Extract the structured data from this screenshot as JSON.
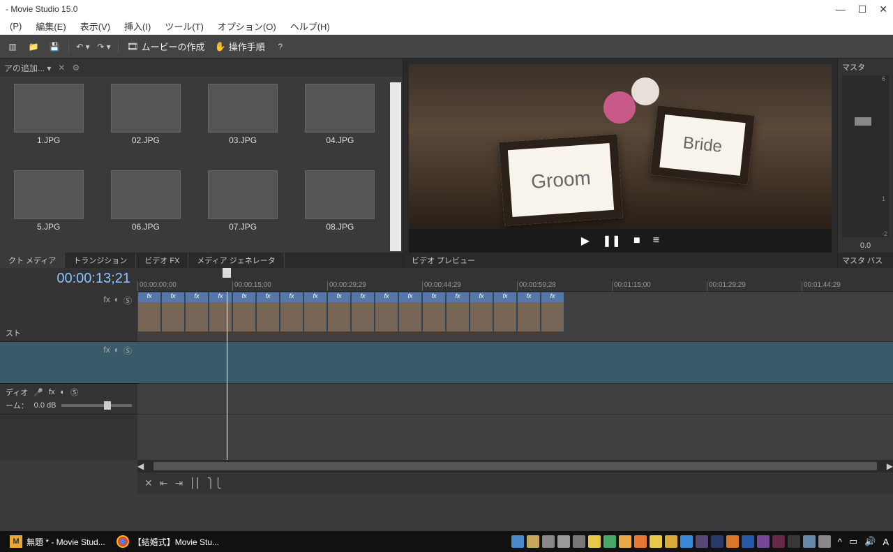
{
  "window": {
    "title": "- Movie Studio 15.0"
  },
  "menus": [
    "(P)",
    "編集(E)",
    "表示(V)",
    "挿入(I)",
    "ツール(T)",
    "オプション(O)",
    "ヘルプ(H)"
  ],
  "toolbar": {
    "make_movie": "ムービーの作成",
    "procedure": "操作手順"
  },
  "media": {
    "dropdown": "アの追加...",
    "items": [
      {
        "label": "1.JPG"
      },
      {
        "label": "02.JPG"
      },
      {
        "label": "03.JPG"
      },
      {
        "label": "04.JPG"
      },
      {
        "label": "5.JPG"
      },
      {
        "label": "06.JPG"
      },
      {
        "label": "07.JPG"
      },
      {
        "label": "08.JPG"
      }
    ],
    "tabs": [
      "クト メディア",
      "トランジション",
      "ビデオ FX",
      "メディア ジェネレータ"
    ]
  },
  "preview": {
    "frame1": "Groom",
    "frame2": "Bride",
    "tab": "ビデオ プレビュー"
  },
  "master": {
    "title": "マスタ",
    "scale": [
      "6",
      "",
      "",
      "",
      "1",
      "-2"
    ],
    "value": "0.0",
    "tab": "マスタ バス"
  },
  "timeline": {
    "timecode": "00:00:13;21",
    "ruler": [
      "00:00:00;00",
      "00:00:15;00",
      "00:00:29;29",
      "00:00:44;29",
      "00:00:59;28",
      "00:01:15;00",
      "00:01:29;29",
      "00:01:44;29"
    ],
    "track1": {
      "name": "スト",
      "fx_label": "fx"
    },
    "track2_audio": {
      "name": "ディオ",
      "vol_label": "ーム：",
      "vol_value": "0.0 dB"
    },
    "clip_count": 18
  },
  "taskbar": {
    "task1": "無題 * - Movie Stud...",
    "task2": "【結婚式】Movie Stu...",
    "tray_colors": [
      "#4a88cc",
      "#c8a858",
      "#888",
      "#999",
      "#777",
      "#e8c848",
      "#48a868",
      "#e8a848",
      "#e87838",
      "#e8c848",
      "#d8a838",
      "#3a88d8",
      "#584878",
      "#283868",
      "#d87828",
      "#2858a8",
      "#784898",
      "#682848",
      "#383838",
      "#6888a8",
      "#888"
    ]
  }
}
